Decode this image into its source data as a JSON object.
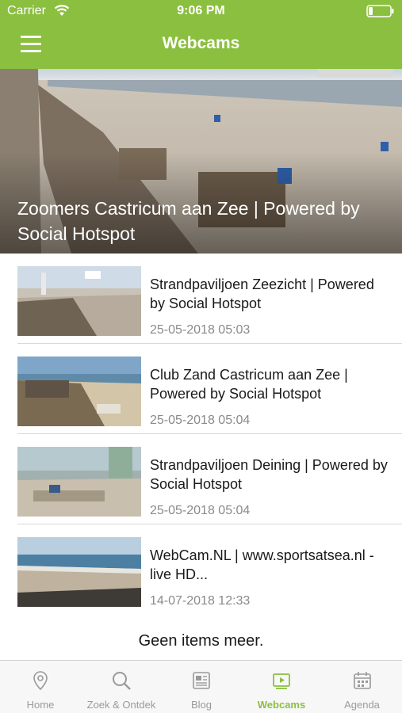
{
  "status_bar": {
    "carrier": "Carrier",
    "time": "9:06 PM"
  },
  "nav": {
    "title": "Webcams"
  },
  "hero": {
    "title": "Zoomers Castricum aan Zee | Powered by Social Hotspot"
  },
  "webcams": [
    {
      "title": "Strandpaviljoen Zeezicht | Powered by Social Hotspot",
      "date": "25-05-2018 05:03"
    },
    {
      "title": "Club Zand Castricum aan Zee | Powered by Social Hotspot",
      "date": "25-05-2018 05:04"
    },
    {
      "title": "Strandpaviljoen Deining | Powered by Social Hotspot",
      "date": "25-05-2018 05:04"
    },
    {
      "title": "WebCam.NL | www.sportsatsea.nl - live HD...",
      "date": "14-07-2018 12:33"
    }
  ],
  "footer": {
    "no_more": "Geen items meer."
  },
  "tabs": [
    {
      "label": "Home",
      "icon": "location-pin-icon"
    },
    {
      "label": "Zoek & Ontdek",
      "icon": "search-icon"
    },
    {
      "label": "Blog",
      "icon": "newspaper-icon"
    },
    {
      "label": "Webcams",
      "icon": "video-play-icon",
      "active": true
    },
    {
      "label": "Agenda",
      "icon": "calendar-icon"
    }
  ],
  "colors": {
    "brand_green": "#8bbf3f",
    "tab_inactive": "#9a9a9a",
    "date_gray": "#8a8a8a"
  }
}
